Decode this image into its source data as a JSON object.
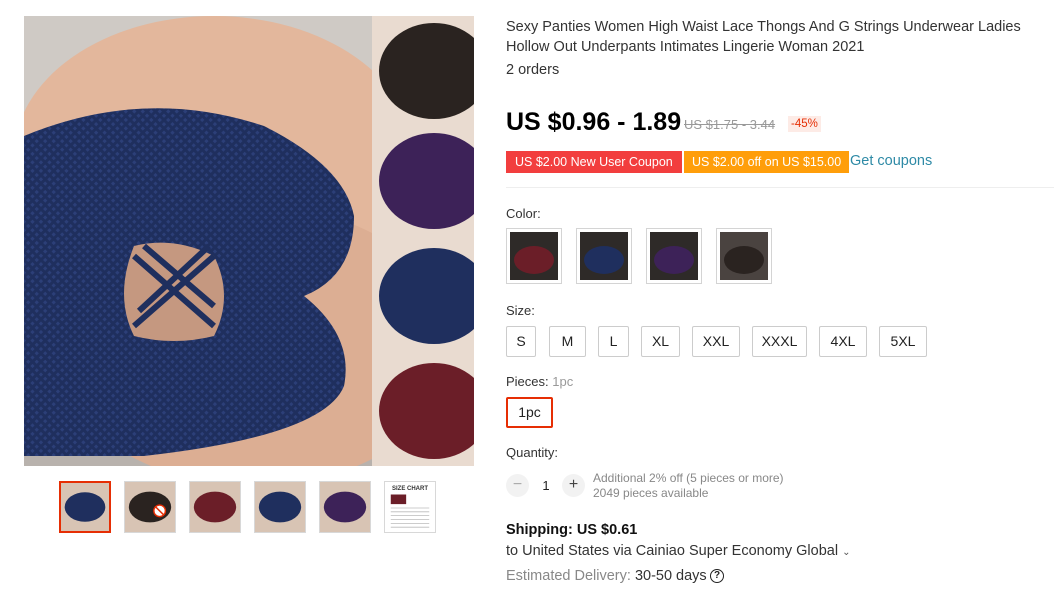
{
  "product": {
    "title": "Sexy Panties Women High Waist Lace Thongs And G Strings Underwear Ladies Hollow Out Underpants Intimates Lingerie Woman 2021",
    "orders": "2 orders",
    "price": "US $0.96 - 1.89",
    "original_price": "US $1.75 - 3.44",
    "discount": "-45%"
  },
  "coupons": {
    "new_user": "US $2.00 New User Coupon",
    "store": "US $2.00 off on US $15.00",
    "get_coupons": "Get coupons"
  },
  "color": {
    "label": "Color:",
    "options": [
      "wine-red",
      "navy-blue",
      "purple",
      "black"
    ],
    "colors": [
      "#6b1e28",
      "#1f2f5e",
      "#3d2258",
      "#2a2320"
    ]
  },
  "size": {
    "label": "Size:",
    "options": [
      "S",
      "M",
      "L",
      "XL",
      "XXL",
      "XXXL",
      "4XL",
      "5XL"
    ]
  },
  "pieces": {
    "label": "Pieces:",
    "selected": "1pc",
    "option": "1pc"
  },
  "quantity": {
    "label": "Quantity:",
    "minus": "−",
    "value": "1",
    "plus": "+",
    "additional": "Additional 2% off (5 pieces or more)",
    "available": "2049 pieces available"
  },
  "shipping": {
    "title": "Shipping: US $0.61",
    "destination": "to United States via Cainiao Super Economy Global",
    "chevron": "⌄",
    "delivery_label": "Estimated Delivery:",
    "delivery_value": "30-50 days",
    "help": "?"
  },
  "gallery": {
    "size_chart_title": "SIZE CHART",
    "accent": "#e62e04"
  }
}
